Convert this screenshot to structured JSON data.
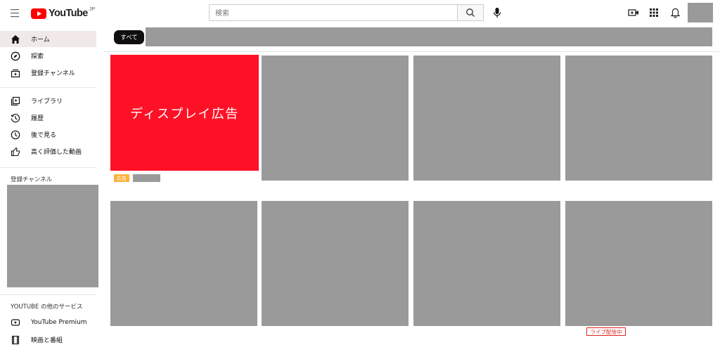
{
  "header": {
    "logo_text": "YouTube",
    "logo_region": "JP",
    "search_placeholder": "検索"
  },
  "sidebar": {
    "primary": [
      {
        "label": "ホーム",
        "icon": "home-icon"
      },
      {
        "label": "探索",
        "icon": "compass-icon"
      },
      {
        "label": "登録チャンネル",
        "icon": "subscriptions-icon"
      }
    ],
    "library": [
      {
        "label": "ライブラリ",
        "icon": "library-icon"
      },
      {
        "label": "履歴",
        "icon": "history-icon"
      },
      {
        "label": "後で見る",
        "icon": "watch-later-icon"
      },
      {
        "label": "高く評価した動画",
        "icon": "thumb-up-icon"
      }
    ],
    "subscriptions_title": "登録チャンネル",
    "more_title": "YOUTUBE の他のサービス",
    "more": [
      {
        "label": "YouTube Premium",
        "icon": "youtube-premium-icon"
      },
      {
        "label": "映画と番組",
        "icon": "film-icon"
      }
    ]
  },
  "chips": {
    "all_label": "すべて"
  },
  "ad": {
    "title": "ディスプレイ広告",
    "badge": "広告"
  },
  "live_badge": "ライブ配信中",
  "colors": {
    "brand_red": "#ff0000",
    "ad_red": "#fe1126",
    "ad_badge": "#fbb13c",
    "placeholder_gray": "#9a9a9a",
    "chip_black": "#0f0f0f"
  }
}
